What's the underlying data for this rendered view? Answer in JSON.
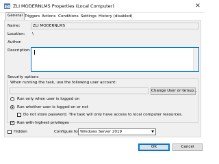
{
  "window": {
    "title": "ZLI MODERNLMS Properties (Local Computer)",
    "close_glyph": "✕"
  },
  "tabs": [
    {
      "label": "General"
    },
    {
      "label": "Triggers"
    },
    {
      "label": "Actions"
    },
    {
      "label": "Conditions"
    },
    {
      "label": "Settings"
    },
    {
      "label": "History (disabled)"
    }
  ],
  "general": {
    "name_label": "Name:",
    "name_value": "ZLI MODERNLMS",
    "location_label": "Location:",
    "location_value": "\\",
    "author_label": "Author:",
    "author_value": "",
    "description_label": "Description:",
    "description_value": ""
  },
  "security": {
    "group_title": "Security options",
    "prompt": "When running the task, use the following user account:",
    "account_value": "",
    "change_user_button": "Change User or Group...",
    "radio_logged_on": "Run only when user is logged on",
    "radio_whether": "Run whether user is logged on or not",
    "no_store_password": "Do not store password.  The task will only have access to local computer resources.",
    "highest_privileges": "Run with highest privileges"
  },
  "bottom": {
    "hidden_label": "Hidden",
    "configure_label": "Configure for:",
    "configure_value": "Windows Server 2019",
    "ok_button": "OK",
    "cancel_button": "Cancel"
  },
  "colors": {
    "accent": "#0078d7",
    "panel_bg": "#f0f0f0"
  }
}
